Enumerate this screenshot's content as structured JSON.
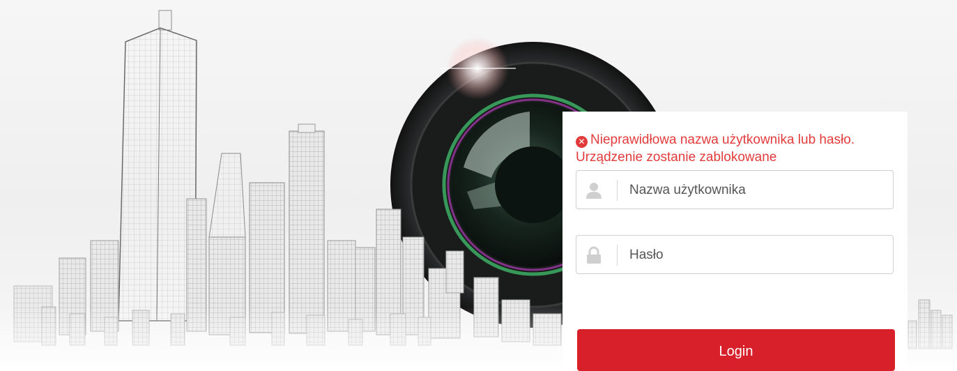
{
  "login": {
    "error_message": "Nieprawidłowa nazwa użytkownika lub hasło. Urządzenie zostanie zablokowane",
    "error_icon": "error-circle-x-icon",
    "username": {
      "placeholder": "Nazwa użytkownika",
      "value": "",
      "icon": "user-icon"
    },
    "password": {
      "placeholder": "Hasło",
      "value": "",
      "icon": "lock-icon"
    },
    "login_button_label": "Login"
  },
  "colors": {
    "error": "#e33b3b",
    "button": "#d8202b",
    "panel": "#ffffff"
  }
}
